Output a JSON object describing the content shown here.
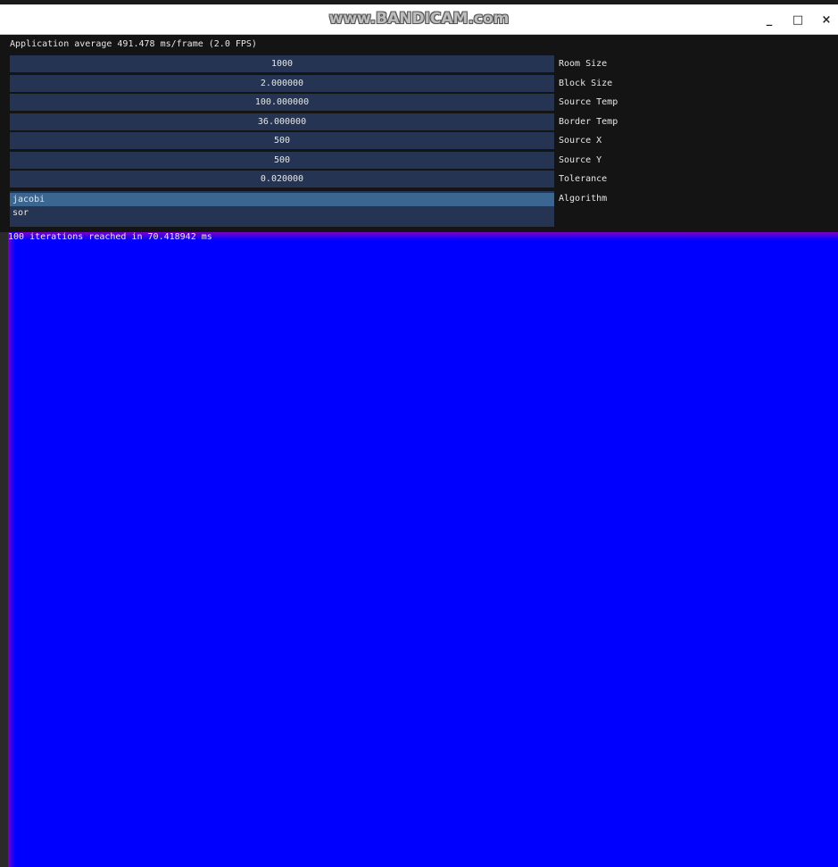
{
  "window": {
    "watermark": "www.BANDICAM.com",
    "minimize_glyph": "_",
    "maximize_glyph": "□",
    "close_glyph": "×"
  },
  "panel": {
    "fps_text": "Application average 491.478 ms/frame (2.0 FPS)",
    "fields": [
      {
        "value": "1000",
        "label": "Room Size"
      },
      {
        "value": "2.000000",
        "label": "Block Size"
      },
      {
        "value": "100.000000",
        "label": "Source Temp"
      },
      {
        "value": "36.000000",
        "label": "Border Temp"
      },
      {
        "value": "500",
        "label": "Source X"
      },
      {
        "value": "500",
        "label": "Source Y"
      },
      {
        "value": "0.020000",
        "label": "Tolerance"
      }
    ],
    "algorithm": {
      "label": "Algorithm",
      "options": [
        "jacobi",
        "sor"
      ],
      "selected": "jacobi"
    }
  },
  "status": "100 iterations reached in 70.418942 ms",
  "colors": {
    "field_bg": "#243452",
    "selected_bg": "#3a6690",
    "heat_cold": "#0000ff",
    "heat_edge": "#7a00c8"
  }
}
